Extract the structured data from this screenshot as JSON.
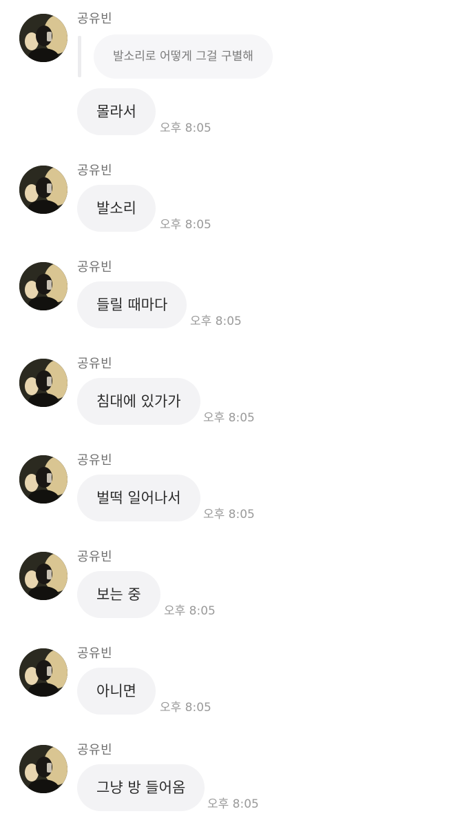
{
  "sender_name": "공유빈",
  "reply": {
    "quoted_text": "발소리로 어떻게 그걸 구별해"
  },
  "messages": [
    {
      "text": "몰라서",
      "time": "오후 8:05"
    },
    {
      "text": "발소리",
      "time": "오후 8:05"
    },
    {
      "text": "들릴 때마다",
      "time": "오후 8:05"
    },
    {
      "text": "침대에 있가가",
      "time": "오후 8:05"
    },
    {
      "text": "벌떡 일어나서",
      "time": "오후 8:05"
    },
    {
      "text": "보는 중",
      "time": "오후 8:05"
    },
    {
      "text": "아니면",
      "time": "오후 8:05"
    },
    {
      "text": "그냥 방 들어옴",
      "time": "오후 8:05"
    }
  ]
}
